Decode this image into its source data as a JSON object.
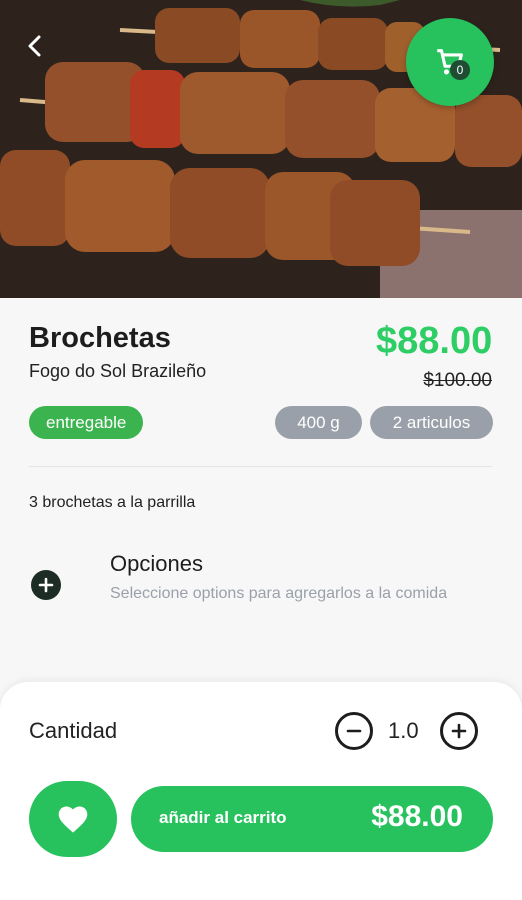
{
  "product": {
    "title": "Brochetas",
    "restaurant": "Fogo do Sol Brazileño",
    "price": "$88.00",
    "old_price": "$100.00",
    "tags": {
      "deliverable": "entregable",
      "weight": "400 g",
      "items": "2 articulos"
    },
    "description": "3 brochetas a la parrilla"
  },
  "options": {
    "title": "Opciones",
    "subtitle": "Seleccione options para agregarlos a la comida"
  },
  "cart": {
    "count": "0"
  },
  "quantity": {
    "label": "Cantidad",
    "value": "1.0"
  },
  "add_to_cart": {
    "label": "añadir al carrito",
    "price": "$88.00"
  },
  "colors": {
    "accent": "#27c25e",
    "price": "#2fcd66",
    "tag_green": "#3bb34e",
    "tag_grey": "#9aa0aa"
  }
}
